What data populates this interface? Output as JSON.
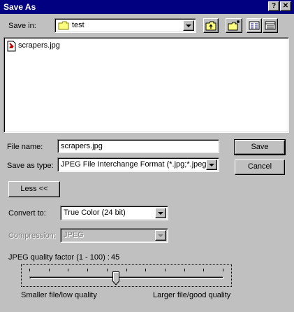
{
  "window": {
    "title": "Save As",
    "help_btn": "?",
    "close_btn": "✕"
  },
  "save_in": {
    "label": "Save in:",
    "folder": "test",
    "folder_icon": "folder-icon"
  },
  "files": [
    {
      "name": "scrapers.jpg",
      "icon": "jpg-file-icon"
    }
  ],
  "file_name": {
    "label": "File name:",
    "value": "scrapers.jpg"
  },
  "save_as_type": {
    "label": "Save as type:",
    "value": "JPEG File Interchange Format (*.jpg;*.jpeg)"
  },
  "buttons": {
    "save": "Save",
    "cancel": "Cancel",
    "less": "Less <<"
  },
  "convert_to": {
    "label": "Convert to:",
    "value": "True Color (24 bit)"
  },
  "compression": {
    "label": "Compression:",
    "value": "JPEG",
    "enabled": false
  },
  "quality": {
    "label": "JPEG quality factor (1 - 100) :",
    "value": "45",
    "min_caption": "Smaller file/low quality",
    "max_caption": "Larger file/good quality"
  }
}
